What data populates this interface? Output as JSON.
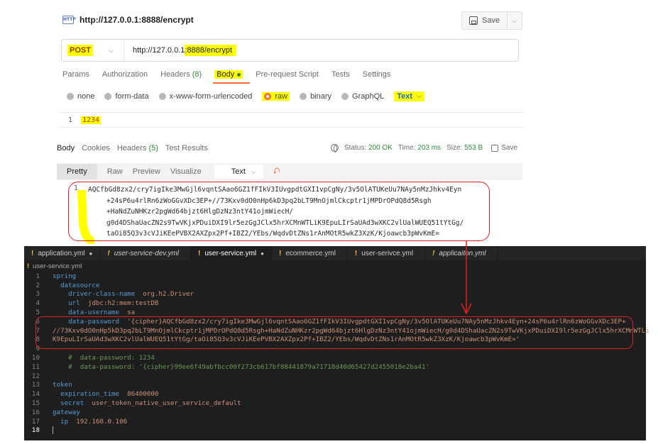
{
  "postman": {
    "request_title": "http://127.0.0.1:8888/encrypt",
    "save_label": "Save",
    "method": "POST",
    "url_prefix": "http://127.0.0.1",
    "url_highlight": ":8888/encrypt",
    "request_tabs": {
      "params": "Params",
      "authorization": "Authorization",
      "headers": "Headers",
      "headers_count": "(8)",
      "body": "Body",
      "pre_request": "Pre-request Script",
      "tests": "Tests",
      "settings": "Settings"
    },
    "body_types": {
      "none": "none",
      "form_data": "form-data",
      "urlencoded": "x-www-form-urlencoded",
      "raw": "raw",
      "binary": "binary",
      "graphql": "GraphQL",
      "format": "Text"
    },
    "request_body": {
      "line_number": "1",
      "value": "1234"
    },
    "response_tabs": {
      "body": "Body",
      "cookies": "Cookies",
      "headers": "Headers",
      "headers_count": "(5)",
      "test_results": "Test Results"
    },
    "response_status": {
      "status_label": "Status:",
      "status_value": "200 OK",
      "time_label": "Time:",
      "time_value": "203 ms",
      "size_label": "Size:",
      "size_value": "553 B",
      "save_label": "Save"
    },
    "view_tabs": {
      "pretty": "Pretty",
      "raw": "Raw",
      "preview": "Preview",
      "visualize": "Visualize",
      "format": "Text"
    },
    "response_body": {
      "line_number": "1",
      "lines": [
        "AQCfbGd8zx2/cry7igIke3MwGjl6vqntSAao6GZ1fFIkV3IUvgpdtGXI1vpCgNy/3v5OlATUKeUu7NAy5nMzJhkv4Eyn",
        "+24sP6u4rlRn6zWoGGvXDc3EP+//73Kxv0dO0nHp6kD3pq2bLT9MnOjmlCkcptr1jMPDrOPdQ8d5Rsgh",
        "+HaNdZuNHKzr2pgWd64bjzt6HlgDzNz3ntY41ojmWiecH/",
        "g0d4DShaUacZN2s9TwVKjxPDuiDXI9lr5ezGgJClx5hrXCMnWTLiK9EpuLIrSaUAd3wXKC2vlUalWUEQ51tYtGg/",
        "taOi85Q3v3cVJiKEePVBX2AXZpx2Pf+IBZ2/YEbs/WqdvDtZNs1rAnMOtR5wkZ3XzK/Kjoawcb3pWvKmE="
      ]
    }
  },
  "vscode": {
    "tabs": [
      {
        "label": "application.yml",
        "modified": "●",
        "italic": false,
        "active": false
      },
      {
        "label": "user-service-dev.yml",
        "modified": "",
        "italic": true,
        "active": false
      },
      {
        "label": "user-service.yml",
        "modified": "●",
        "italic": false,
        "active": true
      },
      {
        "label": "ecommerce.yml",
        "modified": "",
        "italic": false,
        "active": false
      },
      {
        "label": "user-serivce.yml",
        "modified": "",
        "italic": false,
        "active": false
      },
      {
        "label": "applicaiton.yml",
        "modified": "",
        "italic": true,
        "active": false
      }
    ],
    "tab_marker": "!",
    "breadcrumb": "user-service.yml",
    "lines": [
      {
        "n": "1",
        "indent": "",
        "key": "spring",
        "sep": ":",
        "value": "",
        "comment": ""
      },
      {
        "n": "2",
        "indent": "  ",
        "key": "datasource",
        "sep": ":",
        "value": "",
        "comment": ""
      },
      {
        "n": "3",
        "indent": "    ",
        "key": "driver-class-name",
        "sep": ": ",
        "value": "org.h2.Driver",
        "comment": ""
      },
      {
        "n": "4",
        "indent": "    ",
        "key": "url",
        "sep": ": ",
        "value": "jdbc:h2:mem:testDB",
        "comment": ""
      },
      {
        "n": "5",
        "indent": "    ",
        "key": "data-username",
        "sep": ": ",
        "value": "sa",
        "comment": ""
      },
      {
        "n": "6",
        "indent": "    ",
        "key": "data-password",
        "sep": ": ",
        "value": "'{cipher}AQCfbGd8zx2/cry7igIke3MwGjl6vqntSAao6GZ1fFIkV3IUvgpdtGXI1vpCgNy/3v5OlATUKeUu7NAy5nMzJhkv4Eyn+24sP6u4rlRn6zWoGGvXDc3EP+",
        "comment": ""
      },
      {
        "n": "7",
        "indent": "",
        "key": "",
        "sep": "",
        "value": "//73Kxv0dO0nHp5kD3pq2bLT9MnOjmlCkcptr1jMPDrOPdQ8d5Rsgh+HaNdZuNHKzr2pgWd64bjzt6HlgDzNz3ntY41ojmWiecH/g0d4DShaUacZN2s9TwVKjxPDuiDXI9lr5ezGgJClx5hrXCMnWTLi",
        "comment": ""
      },
      {
        "n": "8",
        "indent": "",
        "key": "",
        "sep": "",
        "value": "K9EpuLIrSaUAd3wXKC2vlUalWUEQ51tYtGg/taOi85Q3v3cVJiKEePVBX2AXZpx2Pf+IBZ2/YEbs/WqdvDtZNs1rAnMOtR5wkZ3XzK/Kjoawcb3pWvKmE='",
        "comment": ""
      },
      {
        "n": "9",
        "indent": "",
        "key": "",
        "sep": "",
        "value": "",
        "comment": ""
      },
      {
        "n": "10",
        "indent": "    ",
        "key": "",
        "sep": "",
        "value": "",
        "comment": "#  data-password: 1234"
      },
      {
        "n": "11",
        "indent": "    ",
        "key": "",
        "sep": "",
        "value": "",
        "comment": "#  data-password: '{cipher}99ee6f49abfbcc00f273cb617bf88441879a71718d40d65427d2455018e2ba41'"
      },
      {
        "n": "12",
        "indent": "",
        "key": "",
        "sep": "",
        "value": "",
        "comment": ""
      },
      {
        "n": "13",
        "indent": "",
        "key": "token",
        "sep": ":",
        "value": "",
        "comment": ""
      },
      {
        "n": "14",
        "indent": "  ",
        "key": "expiration_time",
        "sep": ": ",
        "value": "86400000",
        "comment": ""
      },
      {
        "n": "15",
        "indent": "  ",
        "key": "secret",
        "sep": ": ",
        "value": "user_token_native_user_service_default",
        "comment": ""
      },
      {
        "n": "16",
        "indent": "",
        "key": "gateway",
        "sep": ":",
        "value": "",
        "comment": ""
      },
      {
        "n": "17",
        "indent": "  ",
        "key": "ip",
        "sep": ": ",
        "value": "192.168.0.106",
        "comment": ""
      },
      {
        "n": "18",
        "indent": "",
        "key": "",
        "sep": "",
        "value": "",
        "comment": "",
        "current": true
      }
    ]
  },
  "colors": {
    "highlight": "#ffff00",
    "annotation": "#e02020",
    "postman_accent": "#ff6c37",
    "vscode_bg": "#1e1e1e"
  }
}
